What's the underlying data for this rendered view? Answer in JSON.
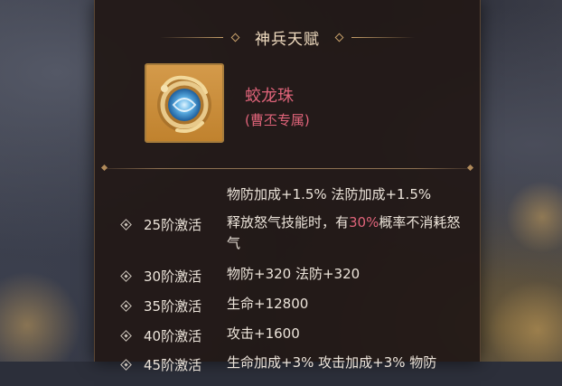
{
  "panel": {
    "title": "神兵天赋",
    "item": {
      "name": "蛟龙珠",
      "subtitle": "(曹丕专属)",
      "icon": "dragon-orb-icon"
    },
    "previous_line": "物防加成+1.5%   法防加成+1.5%",
    "tiers": [
      {
        "level": "25阶激活",
        "desc_pre": "释放怒气技能时，有",
        "desc_highlight": "30%",
        "desc_post": "概率不消耗怒气"
      },
      {
        "level": "30阶激活",
        "desc": "物防+320   法防+320"
      },
      {
        "level": "35阶激活",
        "desc": "生命+12800"
      },
      {
        "level": "40阶激活",
        "desc": "攻击+1600"
      },
      {
        "level": "45阶激活",
        "desc": "生命加成+3%   攻击加成+3%   物防"
      }
    ]
  },
  "colors": {
    "highlight": "#e0647a",
    "text": "#ece4da",
    "gold": "#c7a06a"
  }
}
